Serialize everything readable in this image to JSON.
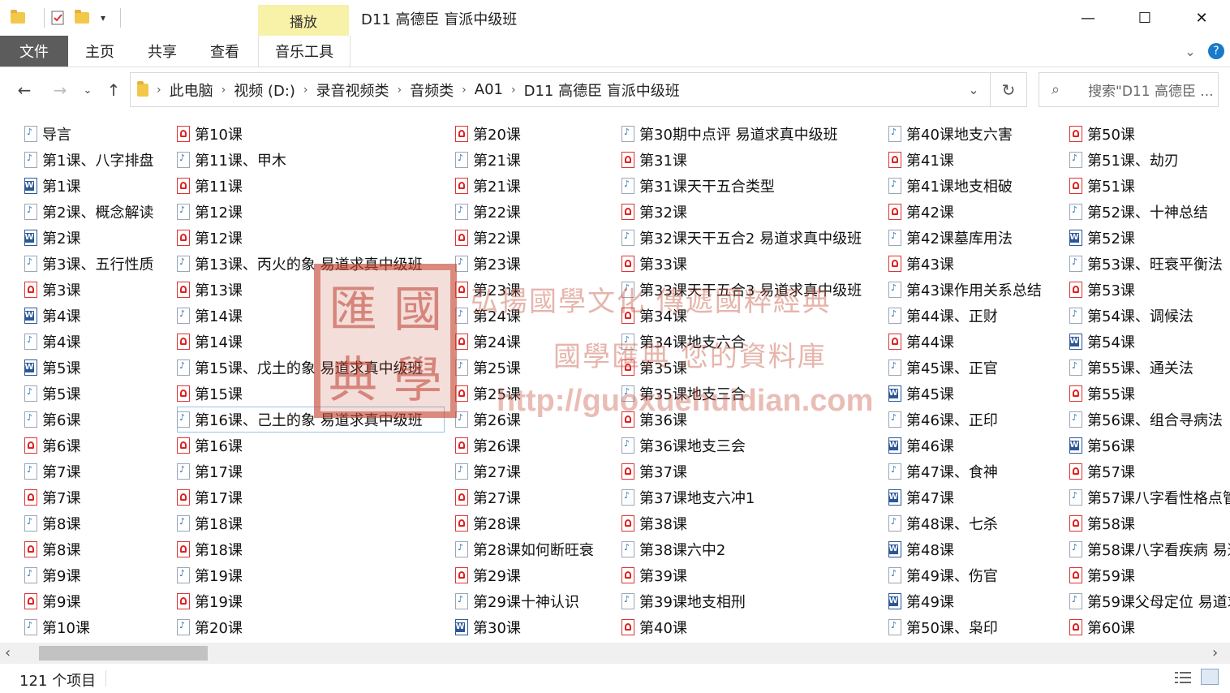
{
  "titlebar": {
    "title": "D11 高德臣 盲派中级班",
    "context_tab": "播放",
    "minimize": "—",
    "maximize": "☐",
    "close": "✕"
  },
  "ribbon": {
    "tabs": [
      "文件",
      "主页",
      "共享",
      "查看",
      "音乐工具"
    ],
    "help": "?"
  },
  "address": {
    "crumbs": [
      "此电脑",
      "视频 (D:)",
      "录音视频类",
      "音频类",
      "A01",
      "D11 高德臣 盲派中级班"
    ]
  },
  "search": {
    "placeholder": "搜索\"D11 高德臣 ..."
  },
  "columns": [
    {
      "items": [
        {
          "name": "导言",
          "type": "mp3"
        },
        {
          "name": "第1课、八字排盘",
          "type": "mp3"
        },
        {
          "name": "第1课",
          "type": "doc"
        },
        {
          "name": "第2课、概念解读",
          "type": "mp3"
        },
        {
          "name": "第2课",
          "type": "doc"
        },
        {
          "name": "第3课、五行性质",
          "type": "mp3"
        },
        {
          "name": "第3课",
          "type": "pdf"
        },
        {
          "name": "第4课",
          "type": "doc"
        },
        {
          "name": "第4课",
          "type": "mp3"
        },
        {
          "name": "第5课",
          "type": "doc"
        },
        {
          "name": "第5课",
          "type": "mp3"
        },
        {
          "name": "第6课",
          "type": "mp3"
        },
        {
          "name": "第6课",
          "type": "pdf"
        },
        {
          "name": "第7课",
          "type": "mp3"
        },
        {
          "name": "第7课",
          "type": "pdf"
        },
        {
          "name": "第8课",
          "type": "mp3"
        },
        {
          "name": "第8课",
          "type": "pdf"
        },
        {
          "name": "第9课",
          "type": "mp3"
        },
        {
          "name": "第9课",
          "type": "pdf"
        },
        {
          "name": "第10课",
          "type": "mp3"
        }
      ]
    },
    {
      "items": [
        {
          "name": "第10课",
          "type": "pdf"
        },
        {
          "name": "第11课、甲木",
          "type": "mp3"
        },
        {
          "name": "第11课",
          "type": "pdf"
        },
        {
          "name": "第12课",
          "type": "mp3"
        },
        {
          "name": "第12课",
          "type": "pdf"
        },
        {
          "name": "第13课、丙火的象 易道求真中级班",
          "type": "mp3"
        },
        {
          "name": "第13课",
          "type": "pdf"
        },
        {
          "name": "第14课",
          "type": "mp3"
        },
        {
          "name": "第14课",
          "type": "pdf"
        },
        {
          "name": "第15课、戊土的象 易道求真中级班",
          "type": "mp3"
        },
        {
          "name": "第15课",
          "type": "pdf"
        },
        {
          "name": "第16课、己土的象 易道求真中级班",
          "type": "mp3",
          "selected": true
        },
        {
          "name": "第16课",
          "type": "pdf"
        },
        {
          "name": "第17课",
          "type": "mp3"
        },
        {
          "name": "第17课",
          "type": "pdf"
        },
        {
          "name": "第18课",
          "type": "mp3"
        },
        {
          "name": "第18课",
          "type": "pdf"
        },
        {
          "name": "第19课",
          "type": "mp3"
        },
        {
          "name": "第19课",
          "type": "pdf"
        },
        {
          "name": "第20课",
          "type": "mp3"
        }
      ]
    },
    {
      "items": [
        {
          "name": "第20课",
          "type": "pdf"
        },
        {
          "name": "第21课",
          "type": "mp3"
        },
        {
          "name": "第21课",
          "type": "pdf"
        },
        {
          "name": "第22课",
          "type": "mp3"
        },
        {
          "name": "第22课",
          "type": "pdf"
        },
        {
          "name": "第23课",
          "type": "mp3"
        },
        {
          "name": "第23课",
          "type": "pdf"
        },
        {
          "name": "第24课",
          "type": "mp3"
        },
        {
          "name": "第24课",
          "type": "pdf"
        },
        {
          "name": "第25课",
          "type": "mp3"
        },
        {
          "name": "第25课",
          "type": "pdf"
        },
        {
          "name": "第26课",
          "type": "mp3"
        },
        {
          "name": "第26课",
          "type": "pdf"
        },
        {
          "name": "第27课",
          "type": "mp3"
        },
        {
          "name": "第27课",
          "type": "pdf"
        },
        {
          "name": "第28课",
          "type": "pdf"
        },
        {
          "name": "第28课如何断旺衰",
          "type": "mp3"
        },
        {
          "name": "第29课",
          "type": "pdf"
        },
        {
          "name": "第29课十神认识",
          "type": "mp3"
        },
        {
          "name": "第30课",
          "type": "doc"
        }
      ]
    },
    {
      "items": [
        {
          "name": "第30期中点评 易道求真中级班",
          "type": "mp3"
        },
        {
          "name": "第31课",
          "type": "pdf"
        },
        {
          "name": "第31课天干五合类型",
          "type": "mp3"
        },
        {
          "name": "第32课",
          "type": "pdf"
        },
        {
          "name": "第32课天干五合2 易道求真中级班",
          "type": "mp3"
        },
        {
          "name": "第33课",
          "type": "pdf"
        },
        {
          "name": "第33课天干五合3 易道求真中级班",
          "type": "mp3"
        },
        {
          "name": "第34课",
          "type": "pdf"
        },
        {
          "name": "第34课地支六合",
          "type": "mp3"
        },
        {
          "name": "第35课",
          "type": "pdf"
        },
        {
          "name": "第35课地支三合",
          "type": "mp3"
        },
        {
          "name": "第36课",
          "type": "pdf"
        },
        {
          "name": "第36课地支三会",
          "type": "mp3"
        },
        {
          "name": "第37课",
          "type": "pdf"
        },
        {
          "name": "第37课地支六冲1",
          "type": "mp3"
        },
        {
          "name": "第38课",
          "type": "pdf"
        },
        {
          "name": "第38课六中2",
          "type": "mp3"
        },
        {
          "name": "第39课",
          "type": "pdf"
        },
        {
          "name": "第39课地支相刑",
          "type": "mp3"
        },
        {
          "name": "第40课",
          "type": "pdf"
        }
      ]
    },
    {
      "items": [
        {
          "name": "第40课地支六害",
          "type": "mp3"
        },
        {
          "name": "第41课",
          "type": "pdf"
        },
        {
          "name": "第41课地支相破",
          "type": "mp3"
        },
        {
          "name": "第42课",
          "type": "pdf"
        },
        {
          "name": "第42课墓库用法",
          "type": "mp3"
        },
        {
          "name": "第43课",
          "type": "pdf"
        },
        {
          "name": "第43课作用关系总结",
          "type": "mp3"
        },
        {
          "name": "第44课、正财",
          "type": "mp3"
        },
        {
          "name": "第44课",
          "type": "pdf"
        },
        {
          "name": "第45课、正官",
          "type": "mp3"
        },
        {
          "name": "第45课",
          "type": "doc"
        },
        {
          "name": "第46课、正印",
          "type": "mp3"
        },
        {
          "name": "第46课",
          "type": "doc"
        },
        {
          "name": "第47课、食神",
          "type": "mp3"
        },
        {
          "name": "第47课",
          "type": "doc"
        },
        {
          "name": "第48课、七杀",
          "type": "mp3"
        },
        {
          "name": "第48课",
          "type": "doc"
        },
        {
          "name": "第49课、伤官",
          "type": "mp3"
        },
        {
          "name": "第49课",
          "type": "doc"
        },
        {
          "name": "第50课、枭印",
          "type": "mp3"
        }
      ]
    },
    {
      "items": [
        {
          "name": "第50课",
          "type": "pdf"
        },
        {
          "name": "第51课、劫刃",
          "type": "mp3"
        },
        {
          "name": "第51课",
          "type": "pdf"
        },
        {
          "name": "第52课、十神总结",
          "type": "mp3"
        },
        {
          "name": "第52课",
          "type": "doc"
        },
        {
          "name": "第53课、旺衰平衡法",
          "type": "mp3"
        },
        {
          "name": "第53课",
          "type": "pdf"
        },
        {
          "name": "第54课、调候法",
          "type": "mp3"
        },
        {
          "name": "第54课",
          "type": "doc"
        },
        {
          "name": "第55课、通关法",
          "type": "mp3"
        },
        {
          "name": "第55课",
          "type": "pdf"
        },
        {
          "name": "第56课、组合寻病法",
          "type": "mp3"
        },
        {
          "name": "第56课",
          "type": "doc"
        },
        {
          "name": "第57课",
          "type": "pdf"
        },
        {
          "name": "第57课八字看性格点管",
          "type": "mp3"
        },
        {
          "name": "第58课",
          "type": "pdf"
        },
        {
          "name": "第58课八字看疾病 易道",
          "type": "mp3"
        },
        {
          "name": "第59课",
          "type": "pdf"
        },
        {
          "name": "第59课父母定位 易道求",
          "type": "mp3"
        },
        {
          "name": "第60课",
          "type": "pdf"
        }
      ]
    }
  ],
  "watermark": {
    "seal_chars": [
      "匯",
      "國",
      "典",
      "學"
    ],
    "line1": "弘揚國學文化  傳遞國粹經典",
    "line2": "國學匯典  您的資料庫",
    "url": "http://guoxuehuidian.com"
  },
  "status": {
    "count": "121 个项目"
  }
}
